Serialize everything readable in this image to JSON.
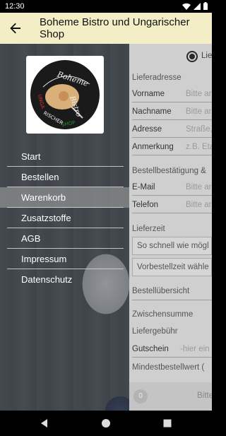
{
  "status_bar": {
    "time": "12:30"
  },
  "toolbar": {
    "title": "Boheme Bistro und Ungarischer Shop"
  },
  "logo": {
    "text_top": "Boheme Bistro",
    "text_bottom": "UNGARISCHER SHOP"
  },
  "drawer": {
    "items": [
      {
        "label": "Start",
        "active": false
      },
      {
        "label": "Bestellen",
        "active": false
      },
      {
        "label": "Warenkorb",
        "active": true
      },
      {
        "label": "Zusatzstoffe",
        "active": false
      },
      {
        "label": "AGB",
        "active": false
      },
      {
        "label": "Impressum",
        "active": false
      },
      {
        "label": "Datenschutz",
        "active": false
      }
    ]
  },
  "form": {
    "delivery_radio_label": "Lief",
    "address_section": "Lieferadresse",
    "fields": [
      {
        "label": "Vorname",
        "placeholder": "Bitte ar"
      },
      {
        "label": "Nachname",
        "placeholder": "Bitte ar"
      },
      {
        "label": "Adresse",
        "placeholder": "Straße,"
      },
      {
        "label": "Anmerkung",
        "placeholder": "z.B. Eta"
      }
    ],
    "confirm_section": "Bestellbestätigung &",
    "contact_fields": [
      {
        "label": "E-Mail",
        "placeholder": "Bitte ar"
      },
      {
        "label": "Telefon",
        "placeholder": "Bitte ar"
      }
    ],
    "time_section": "Lieferzeit",
    "time_options": [
      "So schnell wie mögl",
      "Vorbestellzeit wähle"
    ],
    "overview_section": "Bestellübersicht",
    "subtotal_label": "Zwischensumme",
    "delivery_fee_label": "Liefergebühr",
    "voucher_label": "Gutschein",
    "voucher_placeholder": "-hier ein",
    "minimum_label": "Mindestbestellwert (",
    "bottom_badge": "0",
    "bottom_text": "Bitte"
  },
  "colors": {
    "toolbar": "#f4eec6",
    "accent_red": "#d0342c",
    "accent_green": "#2e8b3a"
  }
}
